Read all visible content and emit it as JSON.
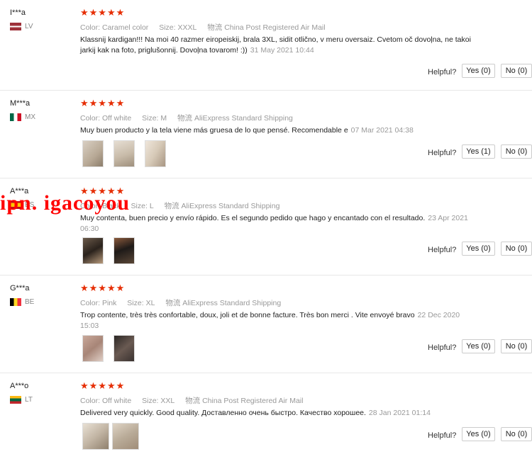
{
  "labels": {
    "color": "Color:",
    "size": "Size:",
    "shipping": "物流",
    "helpful": "Helpful?"
  },
  "watermark": "ipn. igacoyou",
  "reviews": [
    {
      "user": "I***a",
      "country": "LV",
      "color": "Caramel color",
      "size": "XXXL",
      "shipping": "China Post Registered Air Mail",
      "text": "Klassnij kardigan!!! Na moi 40 razmer eiropeiskij, brala 3XL, sidit otlično, v meru oversaiz. Cvetom oč dovoļna, ne takoi jarkij kak na foto, priglušonnij. Dovoļna tovarom! :))",
      "date": "31 May 2021 10:44",
      "yes": "Yes (0)",
      "no": "No (0)"
    },
    {
      "user": "M***a",
      "country": "MX",
      "color": "Off white",
      "size": "M",
      "shipping": "AliExpress Standard Shipping",
      "text": "Muy buen producto y la tela viene más gruesa de lo que pensé. Recomendable e",
      "date": "07 Mar 2021 04:38",
      "yes": "Yes (1)",
      "no": "No (0)"
    },
    {
      "user": "A***a",
      "country": "ES",
      "color": "Black",
      "size": "L",
      "shipping": "AliExpress Standard Shipping",
      "text": "Muy contenta, buen precio y envío rápido. Es el segundo pedido que hago y encantado con el resultado.",
      "date": "23 Apr 2021 06:30",
      "yes": "Yes (0)",
      "no": "No (0)"
    },
    {
      "user": "G***a",
      "country": "BE",
      "color": "Pink",
      "size": "XL",
      "shipping": "AliExpress Standard Shipping",
      "text": "Trop contente, très très confortable, doux, joli et de bonne facture. Très bon merci . Vite envoyé bravo",
      "date": "22 Dec 2020 15:03",
      "yes": "Yes (0)",
      "no": "No (0)"
    },
    {
      "user": "A***o",
      "country": "LT",
      "color": "Off white",
      "size": "XXL",
      "shipping": "China Post Registered Air Mail",
      "text": "Delivered very quickly. Good quality. Доставленно очень быстро. Качество хорошее.",
      "date": "28 Jan 2021 01:14",
      "yes": "Yes (0)",
      "no": "No (0)"
    }
  ],
  "colors": {
    "star": "#e62e04",
    "watermark": "#ff0000",
    "muted": "#999999"
  }
}
